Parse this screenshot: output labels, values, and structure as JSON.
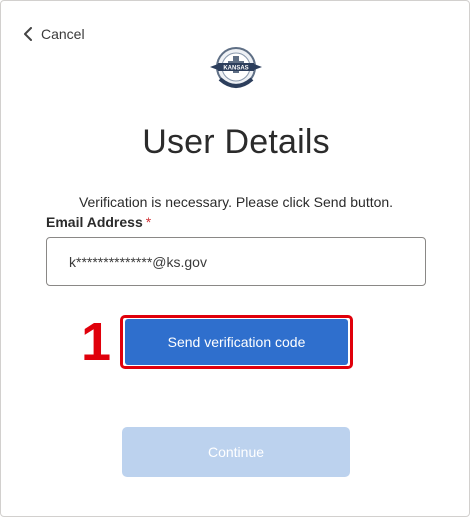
{
  "nav": {
    "cancel_label": "Cancel"
  },
  "logo": {
    "name": "kansas-board-of-nursing-seal",
    "text": "KANSAS",
    "ring_text": "BOARD OF NURSING"
  },
  "page": {
    "title": "User Details",
    "intro": "Verification is necessary. Please click Send button."
  },
  "form": {
    "email_label": "Email Address",
    "required_marker": "*",
    "email_value": "k**************@ks.gov"
  },
  "annotation": {
    "step_number": "1"
  },
  "buttons": {
    "send_label": "Send verification code",
    "continue_label": "Continue"
  },
  "colors": {
    "primary": "#2f6fcd",
    "disabled": "#bcd2ee",
    "annotation": "#e0000b",
    "required": "#d13438"
  }
}
